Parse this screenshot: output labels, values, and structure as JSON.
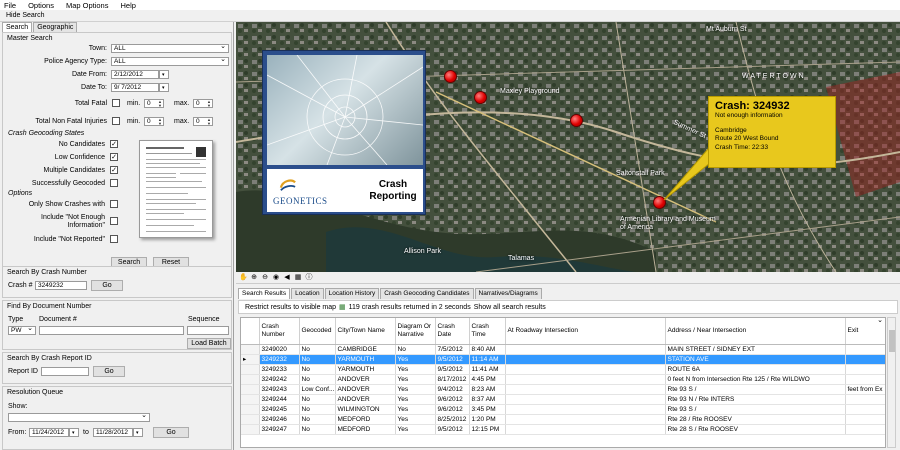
{
  "menu": [
    "File",
    "Options",
    "Map Options",
    "Help"
  ],
  "hide_search": "Hide Search",
  "left_tabs": [
    "Search",
    "Geographic"
  ],
  "master": {
    "title": "Master Search",
    "town_label": "Town:",
    "town_value": "ALL",
    "agency_label": "Police Agency Type:",
    "agency_value": "ALL",
    "date_from_label": "Date From:",
    "date_from": "2/12/2012",
    "date_to_label": "Date To:",
    "date_to": "9/ 7/2012",
    "total_fatal_label": "Total Fatal",
    "total_nonfatal_label": "Total Non Fatal Injuries",
    "min_label": "min.",
    "max_label": "max.",
    "min_val": "0",
    "max_val": "0",
    "geocoding_title": "Crash Geocoding States",
    "no_candidates": "No Candidates",
    "low_confidence": "Low Confidence",
    "multiple_candidates": "Multiple Candidates",
    "successfully_geocoded": "Successfully Geocoded",
    "options_title": "Options",
    "only_show": "Only Show Crashes with",
    "include_nei": "Include \"Not Enough Information\"",
    "include_nr": "Include \"Not Reported\"",
    "search_btn": "Search",
    "reset_btn": "Reset"
  },
  "crash_number": {
    "title": "Search By Crash Number",
    "label": "Crash #",
    "value": "3249232",
    "go": "Go"
  },
  "document": {
    "title": "Find By Document Number",
    "type_label": "Type",
    "doc_label": "Document #",
    "seq_label": "Sequence",
    "type_value": "PW",
    "load_batch": "Load Batch"
  },
  "report": {
    "title": "Search By Crash Report ID",
    "label": "Report ID",
    "go": "Go"
  },
  "resolution": {
    "title": "Resolution Queue",
    "show_label": "Show:",
    "from_label": "From:",
    "from_value": "11/24/2012",
    "to_label": "to",
    "to_value": "11/28/2012",
    "go": "Go"
  },
  "map": {
    "card_title": "Crash Reporting",
    "brand": "GEONETICS",
    "labels": {
      "watertown": "WATERTOWN",
      "maxley": "Maxley Playground",
      "saltonstall": "Saltonstall Park",
      "armenian": "Armenian Library and Museum of America",
      "allison": "Allison Park",
      "talamas": "Talamas",
      "summer": "Summer St",
      "mt_auburn": "Mt Auburn St"
    },
    "callout": {
      "title": "Crash: 324932",
      "subtitle": "Not enough information",
      "town": "Cambridge",
      "route": "Route 20 West Bound",
      "time": "Crash Time: 22:33"
    },
    "callout_color": "#e8c81d",
    "pin_color": "#e00000"
  },
  "results": {
    "tabs": [
      "Search Results",
      "Location",
      "Location History",
      "Crash Geocoding Candidates",
      "Narratives/Diagrams"
    ],
    "restrict": "Restrict results to visible map",
    "count_text": "119 crash results returned in 2 seconds",
    "show_all": "Show all search results",
    "columns": [
      "Crash Number",
      "Geocoded",
      "City/Town Name",
      "Diagram Or Narrative",
      "Crash Date",
      "Crash Time",
      "At Roadway Intersection",
      "Address / Near Intersection",
      "Exit"
    ],
    "rows": [
      [
        "3249020",
        "No",
        "CAMBRIDGE",
        "No",
        "7/5/2012",
        "8:40 AM",
        "",
        "MAIN STREET / SIDNEY EXT",
        ""
      ],
      [
        "3249232",
        "No",
        "YARMOUTH",
        "Yes",
        "9/5/2012",
        "11:14 AM",
        "",
        "STATION AVE",
        ""
      ],
      [
        "3249233",
        "No",
        "YARMOUTH",
        "Yes",
        "9/5/2012",
        "11:41 AM",
        "",
        "ROUTE 6A",
        ""
      ],
      [
        "3249242",
        "No",
        "ANDOVER",
        "Yes",
        "8/17/2012",
        "4:45 PM",
        "",
        "0 feet N from Intersection  Rte 125  /  Rte WILDWO",
        ""
      ],
      [
        "3249243",
        "Low Conf...",
        "ANDOVER",
        "Yes",
        "9/4/2012",
        "8:23 AM",
        "",
        "Rte 93 S /",
        "feet  from Ex"
      ],
      [
        "3249244",
        "No",
        "ANDOVER",
        "Yes",
        "9/6/2012",
        "8:37 AM",
        "",
        "Rte 93 N  /  Rte INTERS",
        ""
      ],
      [
        "3249245",
        "No",
        "WILMINGTON",
        "Yes",
        "9/6/2012",
        "3:45 PM",
        "",
        "Rte 93 S /",
        ""
      ],
      [
        "3249246",
        "No",
        "MEDFORD",
        "Yes",
        "8/25/2012",
        "1:20 PM",
        "",
        "Rte 28  /  Rte ROOSEV",
        ""
      ],
      [
        "3249247",
        "No",
        "MEDFORD",
        "Yes",
        "9/5/2012",
        "12:15 PM",
        "",
        "Rte 28 S  /  Rte ROOSEV",
        ""
      ]
    ],
    "selected_color": "#3399ff"
  }
}
